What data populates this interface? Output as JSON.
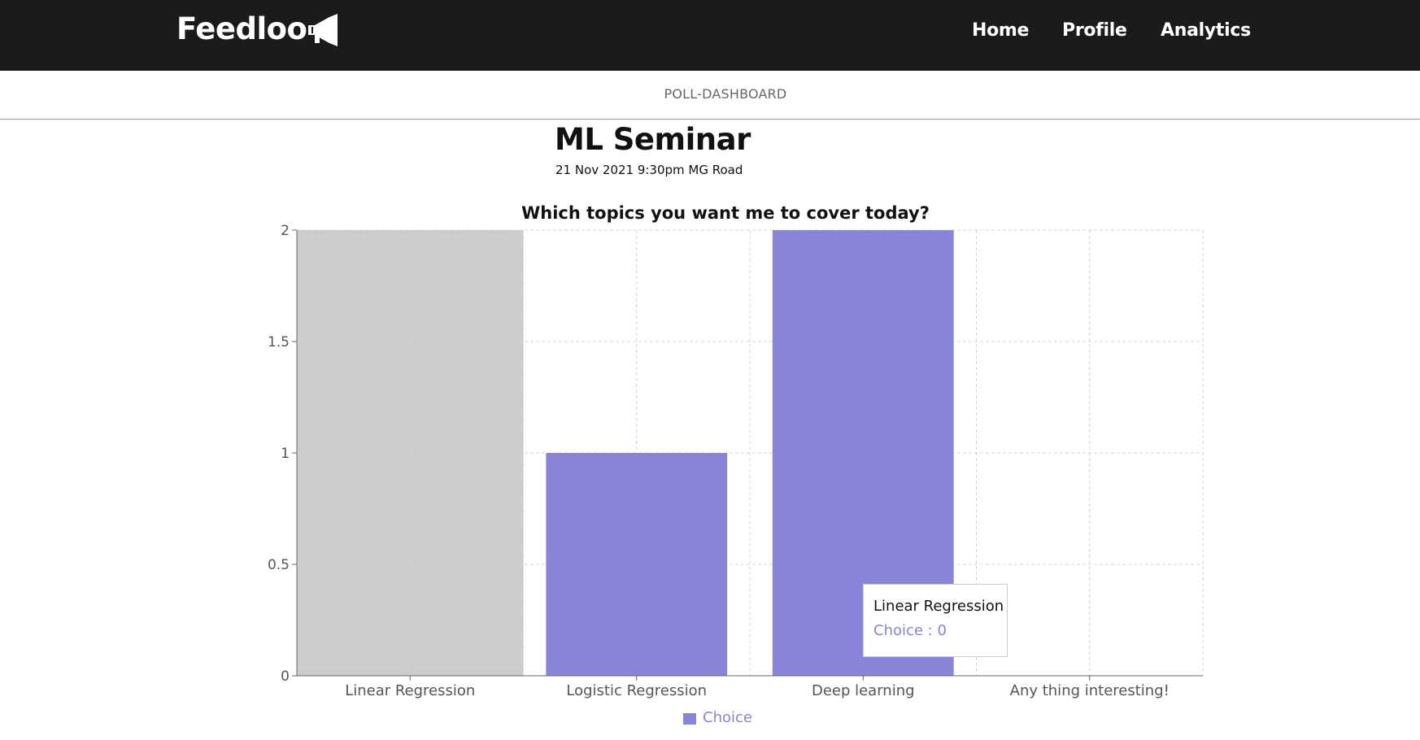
{
  "navbar": {
    "brand": "Feedloo",
    "brand_icon": "megaphone-icon",
    "links": [
      "Home",
      "Profile",
      "Analytics"
    ]
  },
  "subheader": {
    "label": "POLL-DASHBOARD"
  },
  "event": {
    "title": "ML Seminar",
    "meta": "21 Nov 2021 9:30pm MG Road"
  },
  "poll": {
    "question": "Which topics you want me to cover today?"
  },
  "colors": {
    "navbar_bg": "#1c1a1a",
    "bar": "#8884d8",
    "active_bar_background": "#cccccc"
  },
  "chart_data": {
    "type": "bar",
    "categories": [
      "Linear Regression",
      "Logistic Regression",
      "Deep learning",
      "Any thing interesting!"
    ],
    "series": [
      {
        "name": "Choice",
        "values": [
          0,
          1,
          2,
          0
        ]
      }
    ],
    "yticks": [
      "0",
      "0.5",
      "1",
      "1.5",
      "2"
    ],
    "ylim": [
      0,
      2
    ],
    "grid": true,
    "legend": "bottom-center",
    "hovered_category": "Linear Regression"
  },
  "tooltip": {
    "title": "Linear Regression",
    "value_text": "Choice : 0"
  },
  "legend": {
    "label": "Choice"
  }
}
